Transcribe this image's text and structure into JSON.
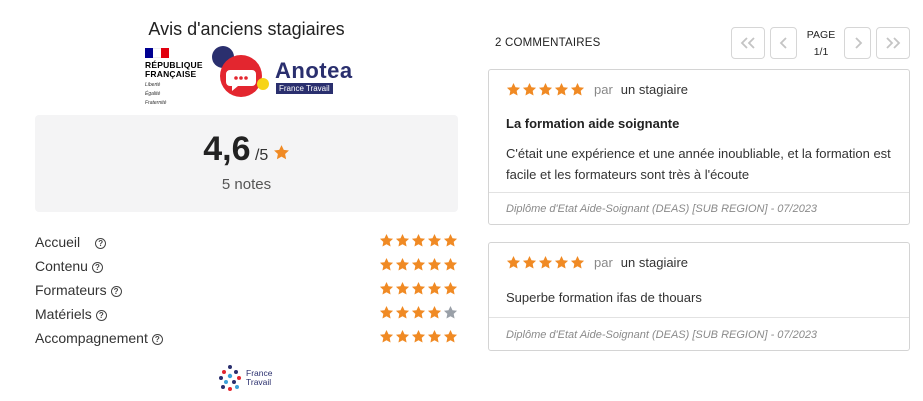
{
  "header": {
    "title": "Avis d'anciens stagiaires",
    "rf_name_1": "RÉPUBLIQUE",
    "rf_name_2": "FRANÇAISE",
    "rf_motto_1": "Liberté",
    "rf_motto_2": "Égalité",
    "rf_motto_3": "Fraternité",
    "anotea_name": "Anotea",
    "anotea_tag": "France Travail"
  },
  "summary": {
    "score": "4,6",
    "max": "/5",
    "count": "5 notes"
  },
  "criteria": [
    {
      "label": "Accueil",
      "rating": 5
    },
    {
      "label": "Contenu",
      "rating": 5
    },
    {
      "label": "Formateurs",
      "rating": 5
    },
    {
      "label": "Matériels",
      "rating": 4
    },
    {
      "label": "Accompagnement",
      "rating": 5
    }
  ],
  "footer_logo": {
    "line1": "France",
    "line2": "Travail"
  },
  "comments_header": {
    "count_label": "2 COMMENTAIRES",
    "page_label": "PAGE",
    "page_value": "1/1",
    "first_icon": "double-chevron-left-icon",
    "prev_icon": "chevron-left-icon",
    "next_icon": "chevron-right-icon",
    "last_icon": "double-chevron-right-icon"
  },
  "comments": [
    {
      "rating": 5,
      "by": "par",
      "author": "un stagiaire",
      "title": "La formation aide soignante",
      "text": "C'était une expérience et une année inoubliable, et la formation est facile et les formateurs sont très à l'écoute",
      "footer": "Diplôme d'Etat Aide-Soignant (DEAS) [SUB REGION] - 07/2023"
    },
    {
      "rating": 5,
      "by": "par",
      "author": "un stagiaire",
      "title": "",
      "text": "Superbe formation ifas de thouars",
      "footer": "Diplôme d'Etat Aide-Soignant (DEAS) [SUB REGION] - 07/2023"
    }
  ],
  "colors": {
    "star_on": "#f08a24",
    "star_off": "#9aa0a8",
    "brand_navy": "#2a2f6e",
    "anotea_red": "#e3262f",
    "anotea_yellow": "#f7d417",
    "rf_blue": "#000091",
    "rf_red": "#e1000f"
  }
}
